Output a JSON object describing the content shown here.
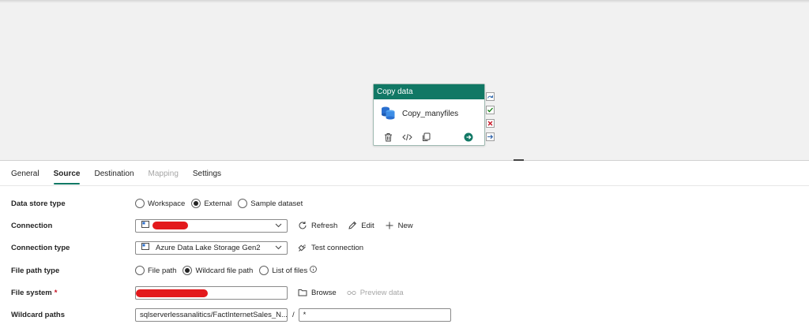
{
  "canvas": {
    "activity": {
      "type_label": "Copy data",
      "name": "Copy_manyfiles"
    }
  },
  "tabs": [
    {
      "label": "General",
      "state": "normal"
    },
    {
      "label": "Source",
      "state": "active"
    },
    {
      "label": "Destination",
      "state": "normal"
    },
    {
      "label": "Mapping",
      "state": "disabled"
    },
    {
      "label": "Settings",
      "state": "normal"
    }
  ],
  "source": {
    "data_store_type": {
      "label": "Data store type",
      "options": [
        "Workspace",
        "External",
        "Sample dataset"
      ],
      "selected": "External"
    },
    "connection": {
      "label": "Connection",
      "value": "",
      "refresh_label": "Refresh",
      "edit_label": "Edit",
      "new_label": "New"
    },
    "connection_type": {
      "label": "Connection type",
      "value": "Azure Data Lake Storage Gen2",
      "test_label": "Test connection"
    },
    "file_path_type": {
      "label": "File path type",
      "options": [
        "File path",
        "Wildcard file path",
        "List of files"
      ],
      "selected": "Wildcard file path"
    },
    "file_system": {
      "label": "File system",
      "required_marker": "*",
      "value": "",
      "browse_label": "Browse",
      "preview_label": "Preview data"
    },
    "wildcard_paths": {
      "label": "Wildcard paths",
      "folder_value": "sqlserverlessanalitics/FactInternetSales_N...",
      "separator": "/",
      "file_value": "*"
    }
  },
  "colors": {
    "accent": "#117865",
    "redaction": "#e3191c",
    "canvas_bg": "#f1f1f1"
  }
}
